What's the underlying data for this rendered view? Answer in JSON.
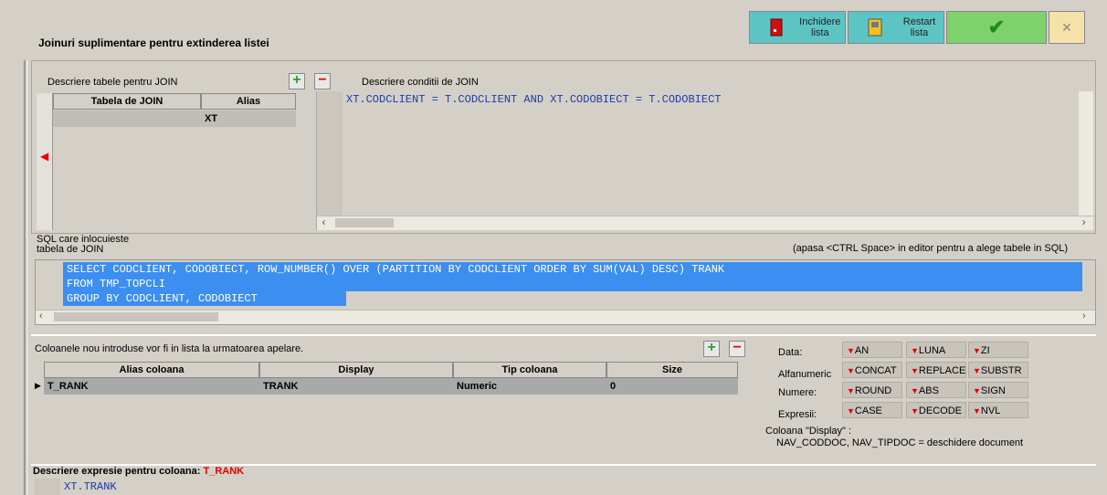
{
  "header": {
    "title": "Joinuri suplimentare pentru extinderea listei",
    "close_label_1": "Inchidere",
    "close_label_2": "lista",
    "restart_label_1": "Restart",
    "restart_label_2": "lista",
    "ok_symbol": "✔",
    "x_symbol": "✕"
  },
  "join_tables": {
    "label": "Descriere tabele pentru JOIN",
    "headers": [
      "Tabela de JOIN",
      "Alias"
    ],
    "rows": [
      {
        "table": "",
        "alias": "XT"
      }
    ]
  },
  "join_conditions": {
    "label": "Descriere conditii de JOIN",
    "text": "XT.CODCLIENT = T.CODCLIENT AND XT.CODOBIECT = T.CODOBIECT"
  },
  "sql": {
    "label_1": "SQL care inlocuieste",
    "label_2": "tabela de JOIN",
    "hint": "(apasa <CTRL Space> in editor pentru a alege tabele in SQL)",
    "line1": "SELECT CODCLIENT, CODOBIECT, ROW_NUMBER() OVER (PARTITION BY CODCLIENT ORDER BY SUM(VAL) DESC) TRANK",
    "line2": "FROM TMP_TOPCLI",
    "line3": "GROUP BY CODCLIENT, CODOBIECT"
  },
  "columns": {
    "label": "Coloanele nou introduse vor fi in lista la urmatoarea apelare.",
    "headers": [
      "Alias coloana",
      "Display",
      "Tip coloana",
      "Size"
    ],
    "rows": [
      {
        "alias": "T_RANK",
        "display": "TRANK",
        "type": "Numeric",
        "size": "0"
      }
    ]
  },
  "functions": {
    "data_label": "Data:",
    "alfa_label": "Alfanumeric",
    "num_label": "Numere:",
    "expr_label": "Expresii:",
    "data": [
      "AN",
      "LUNA",
      "ZI"
    ],
    "alfa": [
      "CONCAT",
      "REPLACE",
      "SUBSTR"
    ],
    "num": [
      "ROUND",
      "ABS",
      "SIGN"
    ],
    "expr": [
      "CASE",
      "DECODE",
      "NVL"
    ],
    "note_1": "Coloana \"Display\" :",
    "note_2": "NAV_CODDOC, NAV_TIPDOC = deschidere document"
  },
  "expression": {
    "label": "Descriere expresie pentru coloana:",
    "column": "T_RANK",
    "text": "XT.TRANK"
  }
}
